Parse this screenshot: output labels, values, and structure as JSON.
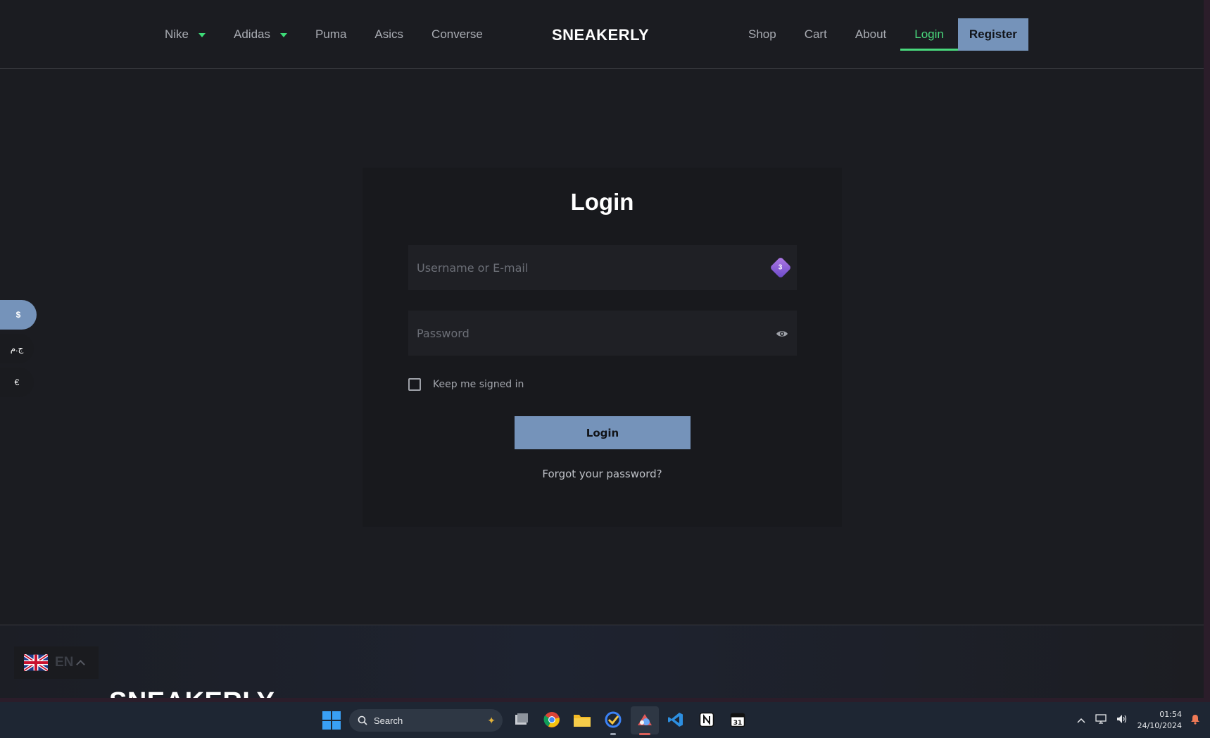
{
  "header": {
    "nav_left": [
      {
        "label": "Nike",
        "has_dropdown": true
      },
      {
        "label": "Adidas",
        "has_dropdown": true
      },
      {
        "label": "Puma",
        "has_dropdown": false
      },
      {
        "label": "Asics",
        "has_dropdown": false
      },
      {
        "label": "Converse",
        "has_dropdown": false
      }
    ],
    "brand": "SNEAKERLY",
    "nav_right": {
      "shop": "Shop",
      "cart": "Cart",
      "about": "About",
      "login": "Login",
      "register": "Register"
    },
    "active_item": "Login"
  },
  "currency": {
    "options": [
      "$",
      "ج.م",
      "€"
    ],
    "selected": "$"
  },
  "login_card": {
    "title": "Login",
    "username_placeholder": "Username or E-mail",
    "username_badge": "3",
    "password_placeholder": "Password",
    "keep_signed_in": "Keep me signed in",
    "keep_signed_in_checked": false,
    "submit": "Login",
    "forgot": "Forgot your password?"
  },
  "footer": {
    "language_code": "EN",
    "language_flag": "uk-flag-icon",
    "brand": "SNEAKERLY"
  },
  "taskbar": {
    "search_label": "Search",
    "apps": [
      "file-explorer-icon",
      "chrome-icon",
      "folder-icon",
      "todo-icon",
      "drawing-app-icon",
      "vscode-icon",
      "notion-icon",
      "calendar-icon"
    ],
    "time": "01:54",
    "date": "24/10/2024"
  },
  "colors": {
    "background": "#1b1c21",
    "accent_blue": "#7593ba",
    "accent_green": "#49d87c",
    "card": "#18191d",
    "field": "#1f2025"
  }
}
